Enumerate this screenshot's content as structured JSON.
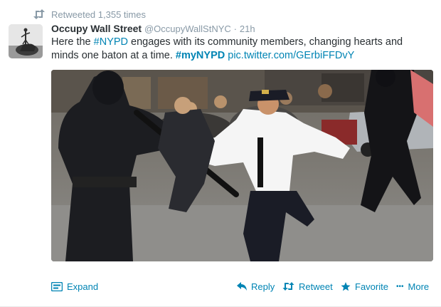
{
  "retweet": {
    "label": "Retweeted 1,355 times",
    "icon": "retweet-icon"
  },
  "tweet": {
    "fullname": "Occupy Wall Street",
    "username": "@OccupyWallStNYC",
    "separator": "·",
    "time": "21h",
    "text_part1": "Here the ",
    "hashtag1": "#NYPD",
    "text_part2": " engages with its community members, changing hearts and minds one baton at a time. ",
    "hashtag2": "#myNYPD",
    "text_part3": " ",
    "link": "pic.twitter.com/GErbiFFDvY"
  },
  "actions": {
    "expand": "Expand",
    "reply": "Reply",
    "retweet": "Retweet",
    "favorite": "Favorite",
    "more_dots": "•••",
    "more": "More"
  },
  "colors": {
    "link": "#0084b4",
    "muted": "#8899a6",
    "text": "#292f33"
  }
}
